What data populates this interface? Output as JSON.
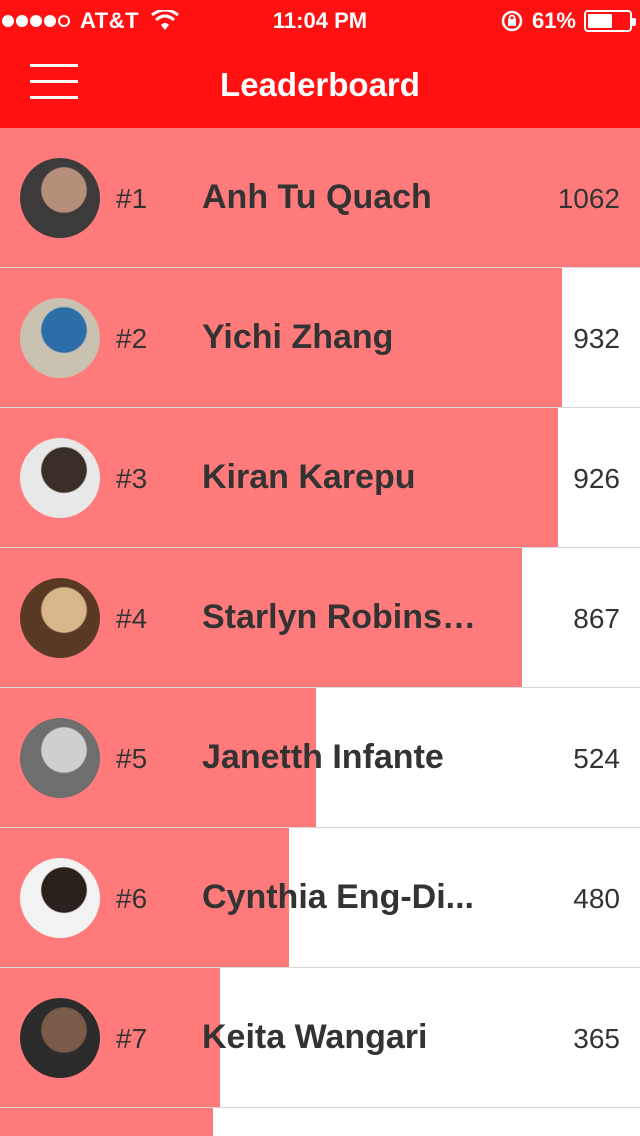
{
  "status_bar": {
    "carrier": "AT&T",
    "signal_dots_filled": 4,
    "signal_dots_total": 5,
    "time": "11:04 PM",
    "battery_text": "61%",
    "battery_level": 0.61
  },
  "nav": {
    "title": "Leaderboard",
    "menu_icon": "hamburger-menu-icon"
  },
  "colors": {
    "header": "#ff1111",
    "bar": "#ff7b7b"
  },
  "leaderboard": [
    {
      "rank": "#1",
      "name": "Anh Tu Quach",
      "score": "1062",
      "avatar_colors": [
        "#3c3a3a",
        "#b58f7a"
      ]
    },
    {
      "rank": "#2",
      "name": "Yichi Zhang",
      "score": "932",
      "avatar_colors": [
        "#c9c2b0",
        "#2b6ea8"
      ]
    },
    {
      "rank": "#3",
      "name": "Kiran Karepu",
      "score": "926",
      "avatar_colors": [
        "#e8e8e8",
        "#3a2e28"
      ]
    },
    {
      "rank": "#4",
      "name": "Starlyn Robinson",
      "score": "867",
      "avatar_colors": [
        "#5a3a25",
        "#d8b68a"
      ]
    },
    {
      "rank": "#5",
      "name": "Janetth Infante",
      "score": "524",
      "avatar_colors": [
        "#6e6e6e",
        "#cfcfcf"
      ]
    },
    {
      "rank": "#6",
      "name": "Cynthia Eng-Di...",
      "score": "480",
      "avatar_colors": [
        "#f2f2f2",
        "#2a211c"
      ]
    },
    {
      "rank": "#7",
      "name": "Keita Wangari",
      "score": "365",
      "avatar_colors": [
        "#2b2b2b",
        "#7a5a48"
      ]
    }
  ],
  "max_score": 1062
}
